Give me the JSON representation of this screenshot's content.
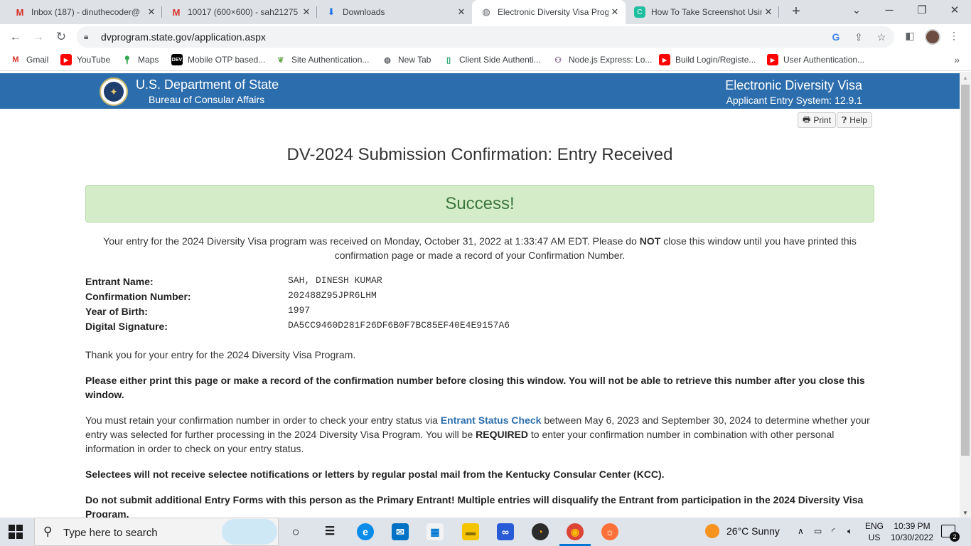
{
  "browser": {
    "tabs": [
      {
        "title": "Inbox (187) - dinuthecoder@",
        "icon": "gmail-icon"
      },
      {
        "title": "10017 (600×600) - sah21275",
        "icon": "gmail-icon"
      },
      {
        "title": "Downloads",
        "icon": "download-icon"
      },
      {
        "title": "Electronic Diversity Visa Prog",
        "icon": "globe-icon"
      },
      {
        "title": "How To Take Screenshot Usin",
        "icon": "site-icon"
      }
    ],
    "url": "dvprogram.state.gov/application.aspx",
    "bookmarks": [
      {
        "label": "Gmail",
        "icon": "gmail-icon"
      },
      {
        "label": "YouTube",
        "icon": "youtube-icon"
      },
      {
        "label": "Maps",
        "icon": "maps-icon"
      },
      {
        "label": "Mobile OTP based...",
        "icon": "dev-icon"
      },
      {
        "label": "Site Authentication...",
        "icon": "leaf-icon"
      },
      {
        "label": "New Tab",
        "icon": "globe-icon"
      },
      {
        "label": "Client Side Authenti...",
        "icon": "doc-icon"
      },
      {
        "label": "Node.js Express: Lo...",
        "icon": "bookmark-icon"
      },
      {
        "label": "Build Login/Registe...",
        "icon": "youtube-icon"
      },
      {
        "label": "User Authentication...",
        "icon": "youtube-icon"
      }
    ]
  },
  "header": {
    "department": "U.S. Department of State",
    "bureau": "Bureau of Consular Affairs",
    "system_name": "Electronic Diversity Visa",
    "system_version": "Applicant Entry System: 12.9.1"
  },
  "actions": {
    "print_label": "Print",
    "help_label": "Help"
  },
  "page": {
    "title": "DV-2024 Submission Confirmation: Entry Received",
    "success": "Success!",
    "received_pre": "Your entry for the 2024 Diversity Visa program was received on Monday, October 31, 2022 at 1:33:47 AM EDT. Please do ",
    "received_bold": "NOT",
    "received_post": " close this window until you have printed this confirmation page or made a record of your Confirmation Number.",
    "details": [
      {
        "label": "Entrant Name:",
        "value": "SAH, DINESH KUMAR"
      },
      {
        "label": "Confirmation Number:",
        "value": "202488Z95JPR6LHM"
      },
      {
        "label": "Year of Birth:",
        "value": "1997"
      },
      {
        "label": "Digital Signature:",
        "value": "DA5CC9460D281F26DF6B0F7BC85EF40E4E9157A6"
      }
    ],
    "thanks": "Thank you for your entry for the 2024 Diversity Visa Program.",
    "print_warning": "Please either print this page or make a record of the confirmation number before closing this window. You will not be able to retrieve this number after you close this window.",
    "retain_pre": "You must retain your confirmation number in order to check your entry status via ",
    "retain_link": "Entrant Status Check",
    "retain_mid": " between May 6, 2023 and September 30, 2024 to determine whether your entry was selected for further processing in the 2024 Diversity Visa Program. You will be ",
    "retain_bold": "REQUIRED",
    "retain_post": " to enter your confirmation number in combination with other personal information in order to check on your entry status.",
    "selectees": "Selectees will not receive selectee notifications or letters by regular postal mail from the Kentucky Consular Center (KCC).",
    "no_additional": "Do not submit additional Entry Forms with this person as the Primary Entrant! Multiple entries will disqualify the Entrant from participation in the 2024 Diversity Visa Program."
  },
  "taskbar": {
    "search_placeholder": "Type here to search",
    "weather": "26°C  Sunny",
    "lang_top": "ENG",
    "lang_bottom": "US",
    "time": "10:39 PM",
    "date": "10/30/2022",
    "notification_count": "2"
  },
  "colors": {
    "banner": "#2c6ead",
    "success_bg": "#d5ecc8",
    "success_text": "#3c763d",
    "link": "#2c6ead"
  }
}
